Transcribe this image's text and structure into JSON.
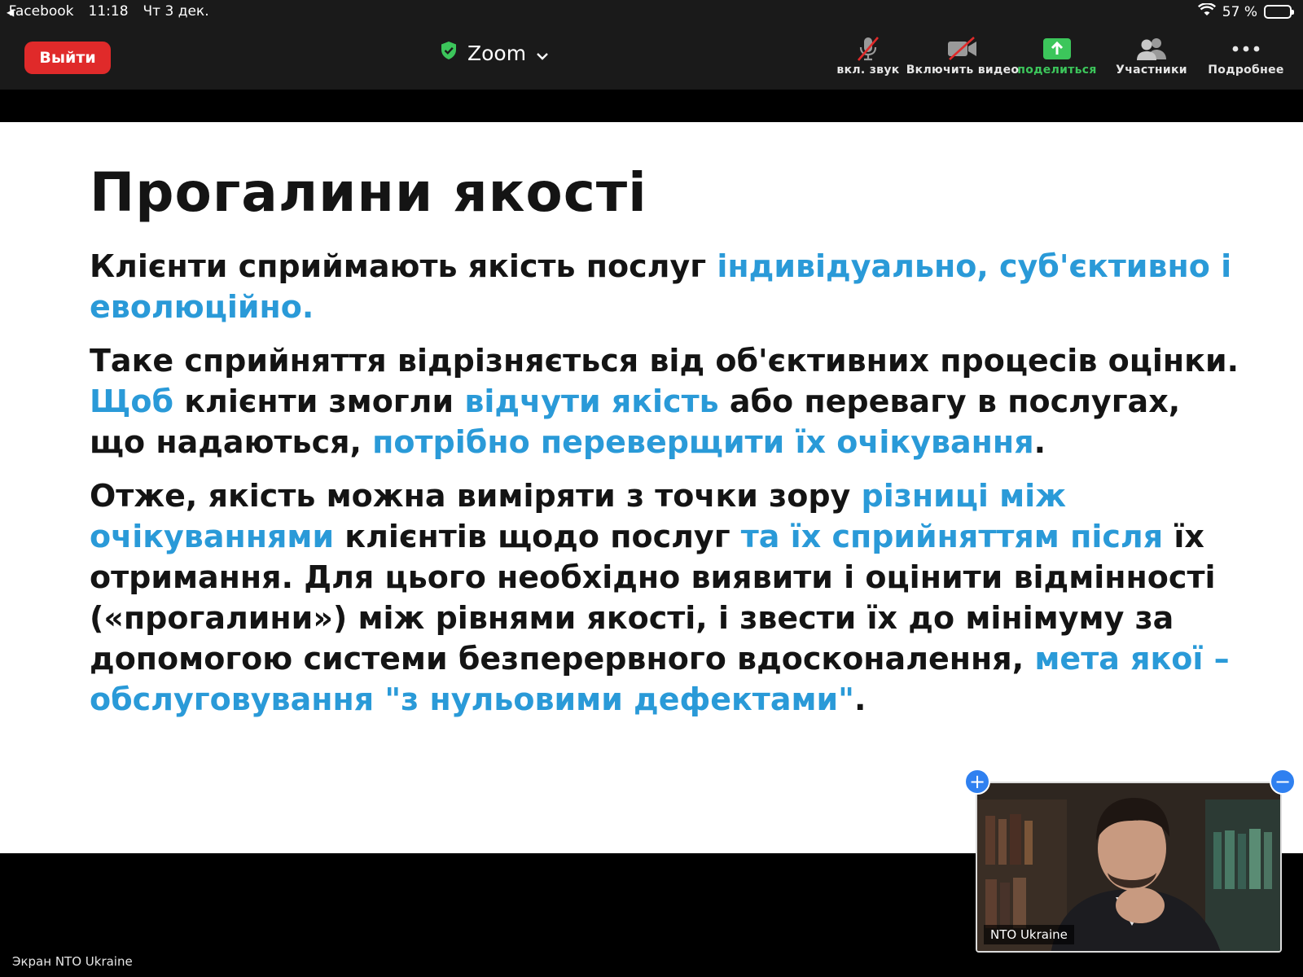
{
  "status_bar": {
    "back_app": "Facebook",
    "time": "11:18",
    "date": "Чт 3 дек.",
    "battery": "57 %",
    "battery_level": 0.57
  },
  "toolbar": {
    "leave_label": "Выйти",
    "meeting_title": "Zoom",
    "tools": [
      {
        "label": "вкл. звук",
        "icon": "muted-microphone-icon"
      },
      {
        "label": "Включить видео",
        "icon": "video-off-icon"
      },
      {
        "label": "поделиться",
        "icon": "share-screen-icon"
      },
      {
        "label": "Участники",
        "icon": "participants-icon"
      },
      {
        "label": "Подробнее",
        "icon": "more-icon"
      }
    ],
    "colors": {
      "leave": "#e02a2a",
      "share": "#3cc65b"
    }
  },
  "slide": {
    "title": "Прогалини якості",
    "p1": {
      "a": "Клієнти сприймають якість послуг ",
      "b": "індивідуально, суб'єктивно і еволюційно."
    },
    "p2": {
      "a": "Таке сприйняття відрізняється від об'єктивних процесів оцінки. ",
      "b": "Щоб",
      "c": " клієнти змогли ",
      "d": "відчути якість",
      "e": " або перевагу в послугах, що надаються, ",
      "f": "потрібно переверщити їх очікування",
      "g": "."
    },
    "p3": {
      "a": "Отже, якість можна виміряти з точки зору ",
      "b": "різниці між очікуваннями",
      "c": " клієнтів щодо послуг ",
      "d": "та їх сприйняттям після",
      "e": " їх отримання. Для цього необхідно виявити і оцінити відмінності («прогалини») між рівнями якості, і звести їх до мінімуму за допомогою системи безперервного вдосконалення, ",
      "f": "мета якої – обслуговування \"з нульовими дефектами\"",
      "g": "."
    },
    "highlight_color": "#2a9ad8"
  },
  "video_tile": {
    "participant_name": "NTO Ukraine"
  },
  "screen_label": "Экран NTO Ukraine"
}
